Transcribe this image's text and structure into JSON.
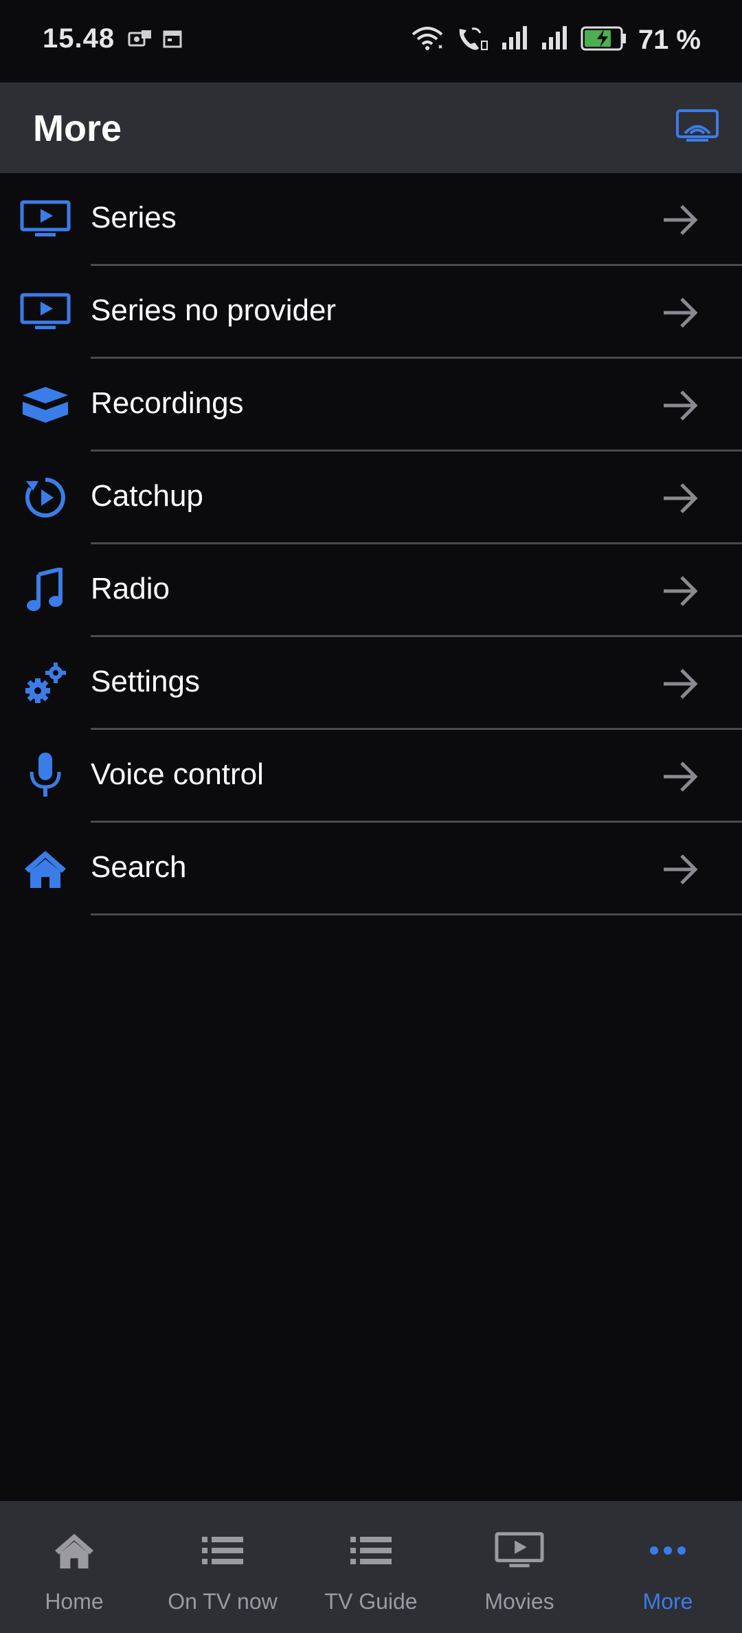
{
  "colors": {
    "accent": "#3b7de8",
    "background": "#0b0b0e",
    "header_bg": "#2e2e35",
    "divider": "#4a4a4f",
    "inactive": "#9a9aa0"
  },
  "status_bar": {
    "time": "15.48",
    "battery": "71 %",
    "icons": [
      "screenshot-icon",
      "calendar-icon",
      "wifi-icon",
      "wifi-call-icon",
      "signal-icon",
      "signal-icon",
      "battery-charging-icon"
    ]
  },
  "header": {
    "title": "More",
    "cast_icon": "cast-icon"
  },
  "menu": {
    "items": [
      {
        "label": "Series",
        "icon": "tv-play-icon"
      },
      {
        "label": "Series no provider",
        "icon": "tv-play-icon"
      },
      {
        "label": "Recordings",
        "icon": "box-open-icon"
      },
      {
        "label": "Catchup",
        "icon": "replay-icon"
      },
      {
        "label": "Radio",
        "icon": "music-note-icon"
      },
      {
        "label": "Settings",
        "icon": "gears-icon"
      },
      {
        "label": "Voice control",
        "icon": "microphone-icon"
      },
      {
        "label": "Search",
        "icon": "home-icon"
      }
    ]
  },
  "bottom_nav": {
    "tabs": [
      {
        "label": "Home",
        "icon": "home-icon"
      },
      {
        "label": "On TV now",
        "icon": "list-icon"
      },
      {
        "label": "TV Guide",
        "icon": "list-icon"
      },
      {
        "label": "Movies",
        "icon": "tv-play-icon"
      },
      {
        "label": "More",
        "icon": "more-dots-icon",
        "active": true
      }
    ]
  }
}
